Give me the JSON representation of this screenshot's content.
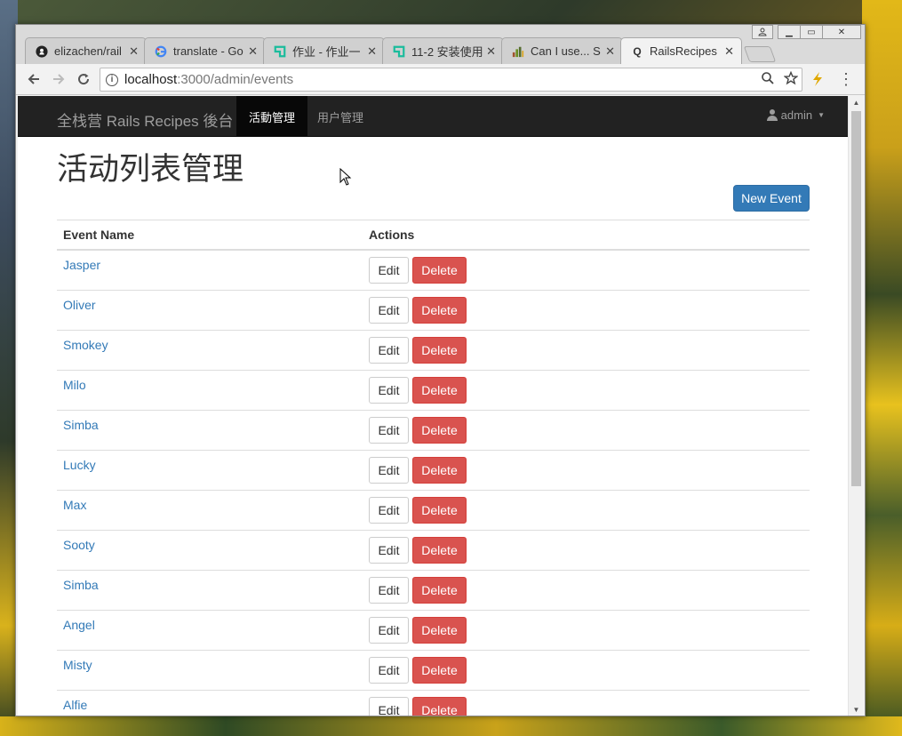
{
  "browser": {
    "tabs": [
      {
        "title": "elizachen/rail",
        "icon": "github-icon"
      },
      {
        "title": "translate - Go",
        "icon": "google-icon"
      },
      {
        "title": "作业 - 作业一",
        "icon": "app-icon"
      },
      {
        "title": "11-2 安装使用",
        "icon": "app-icon"
      },
      {
        "title": "Can I use... S",
        "icon": "caniuse-icon"
      },
      {
        "title": "RailsRecipes",
        "icon": "rails-q-icon"
      }
    ],
    "active_tab": 5,
    "url_host": "localhost",
    "url_rest": ":3000/admin/events"
  },
  "navbar": {
    "brand": "全栈营 Rails Recipes 後台",
    "items": [
      {
        "label": "活動管理",
        "active": true
      },
      {
        "label": "用户管理",
        "active": false
      }
    ],
    "user": "admin"
  },
  "page": {
    "title": "活动列表管理",
    "new_event_label": "New Event"
  },
  "table": {
    "headers": [
      "Event Name",
      "Actions"
    ],
    "edit_label": "Edit",
    "delete_label": "Delete",
    "rows": [
      "Jasper",
      "Oliver",
      "Smokey",
      "Milo",
      "Simba",
      "Lucky",
      "Max",
      "Sooty",
      "Simba",
      "Angel",
      "Misty",
      "Alfie"
    ]
  },
  "colors": {
    "primary": "#337ab7",
    "danger": "#d9534f",
    "navbar": "#222222"
  }
}
